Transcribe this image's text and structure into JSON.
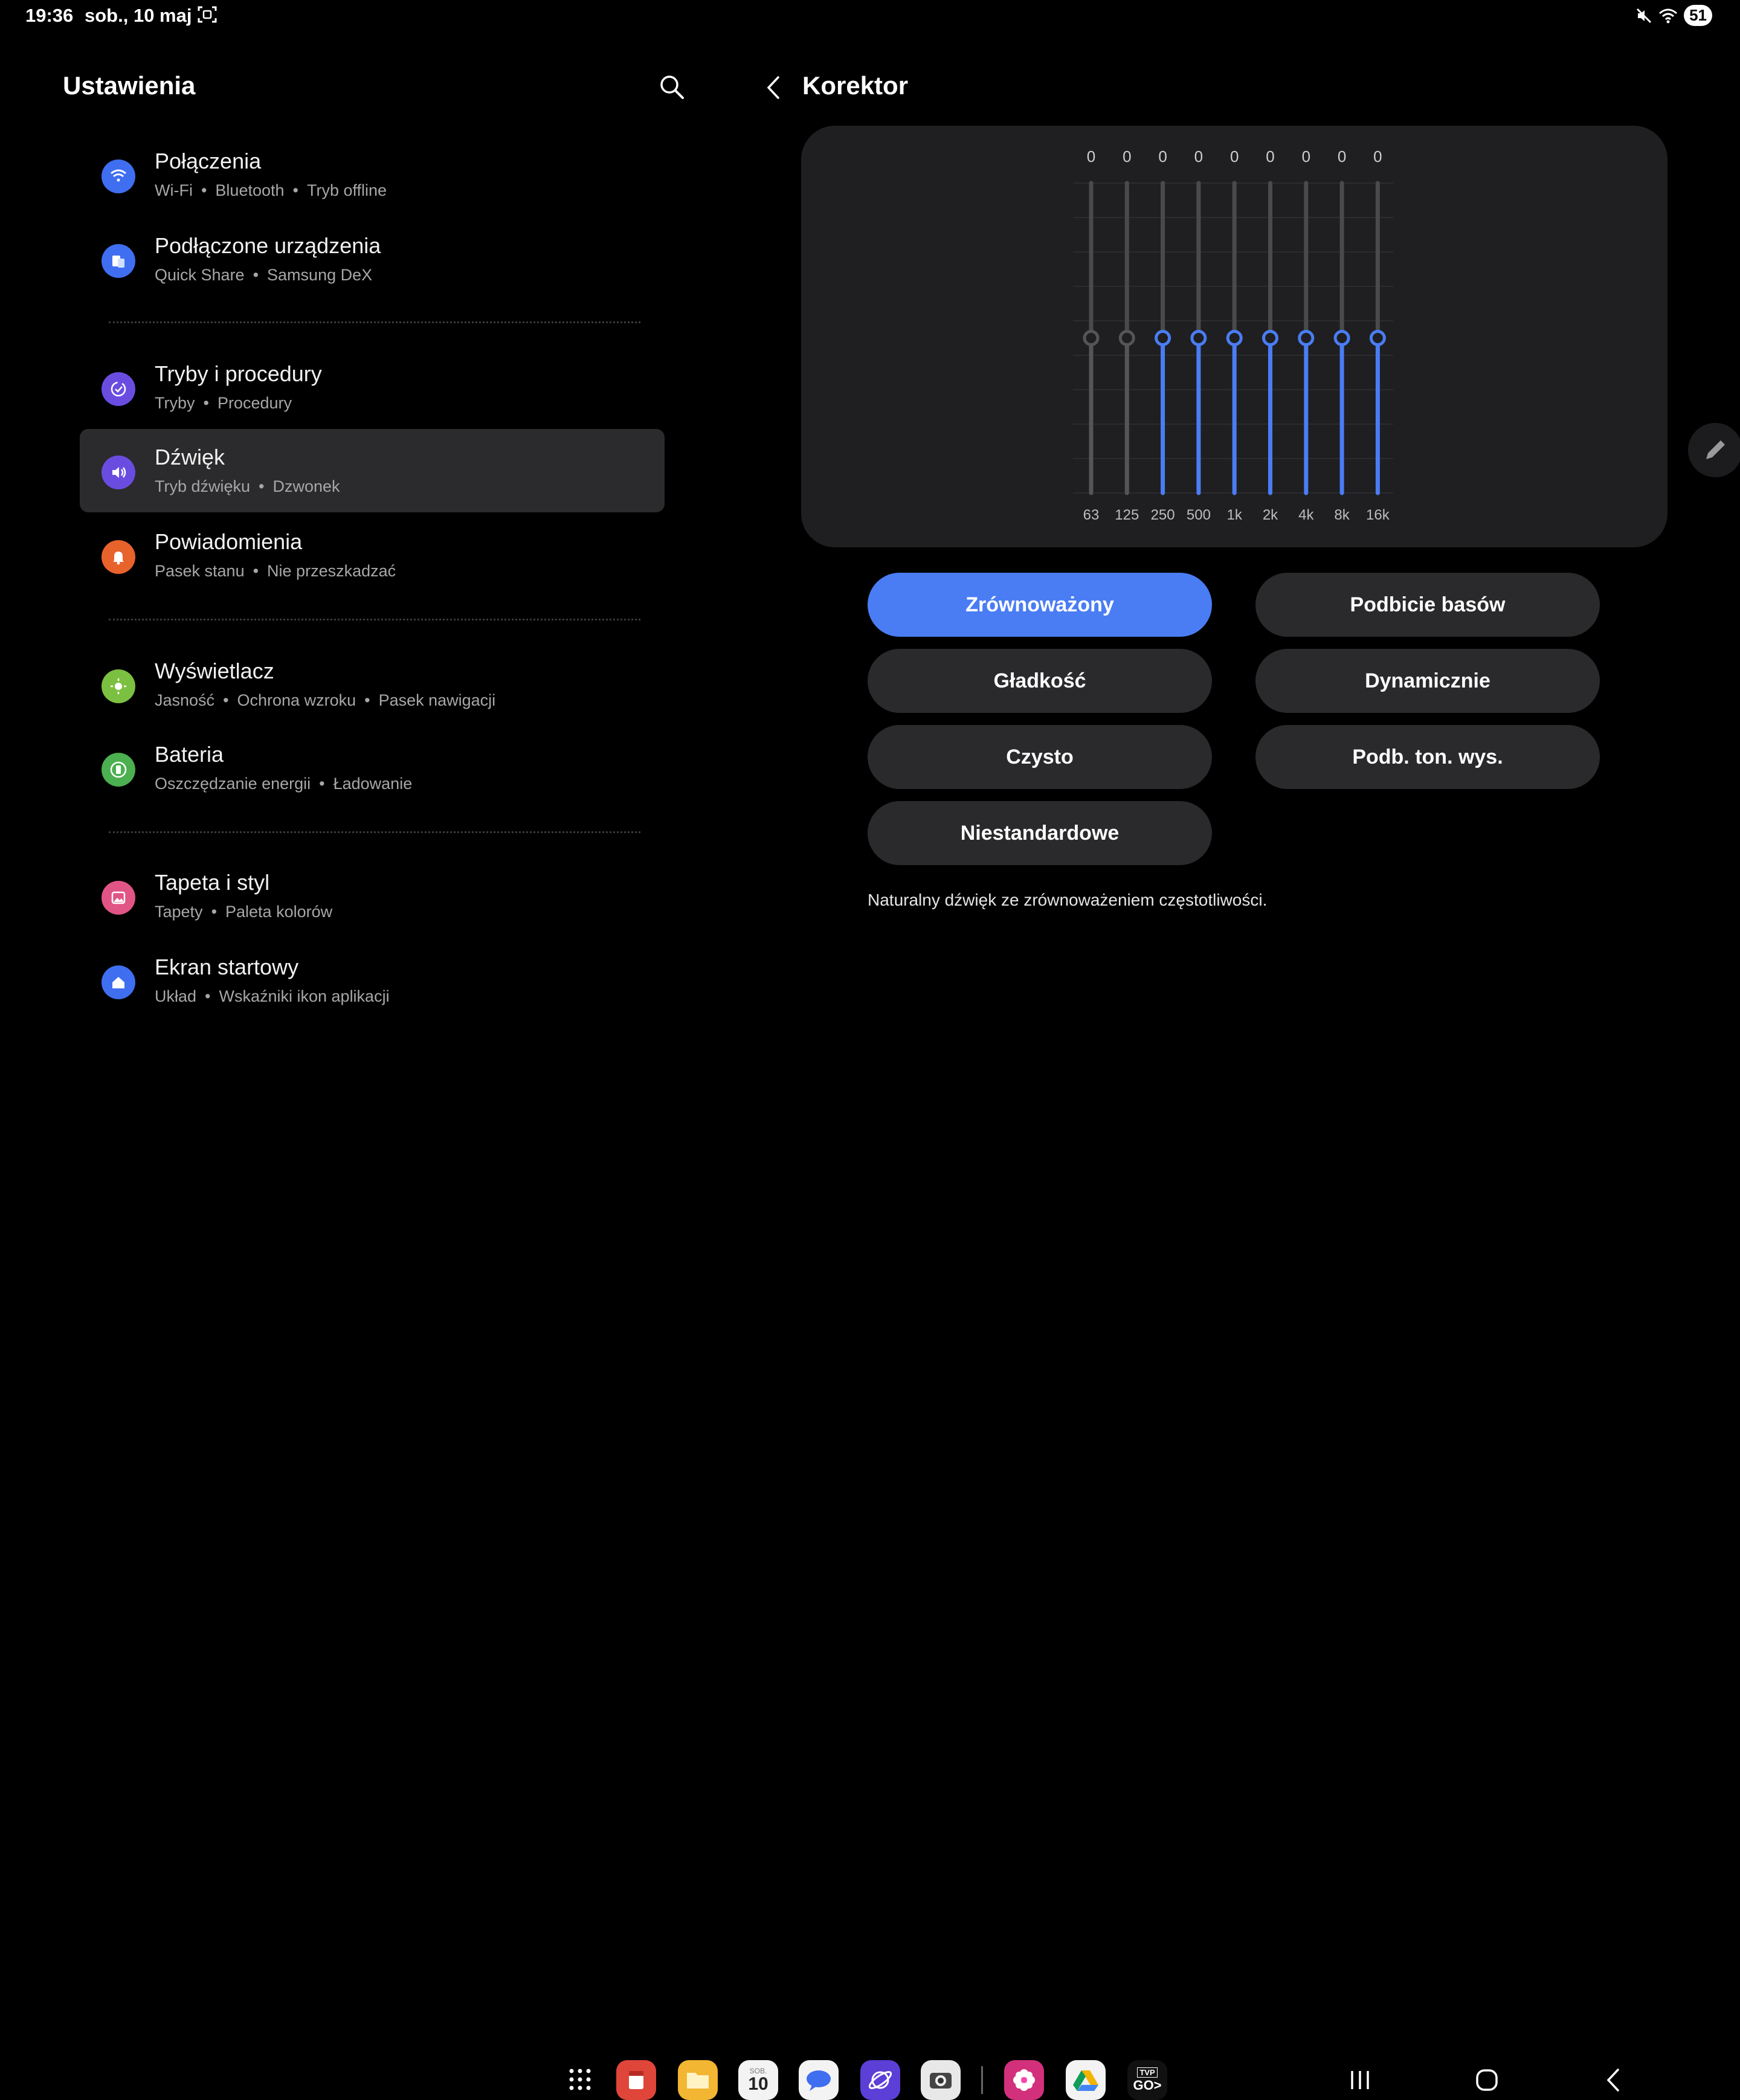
{
  "status_bar": {
    "time": "19:36",
    "date": "sob., 10 maj",
    "battery": "51"
  },
  "left": {
    "title": "Ustawienia",
    "items": [
      {
        "title": "Połączenia",
        "subs": [
          "Wi-Fi",
          "Bluetooth",
          "Tryb offline"
        ],
        "icon": "wifi-icon",
        "color": "#3f6ef0"
      },
      {
        "title": "Podłączone urządzenia",
        "subs": [
          "Quick Share",
          "Samsung DeX"
        ],
        "icon": "devices-icon",
        "color": "#3f6ef0"
      },
      {
        "title": "Tryby i procedury",
        "subs": [
          "Tryby",
          "Procedury"
        ],
        "icon": "routines-icon",
        "color": "#6a4de0"
      },
      {
        "title": "Dźwięk",
        "subs": [
          "Tryb dźwięku",
          "Dzwonek"
        ],
        "icon": "speaker-icon",
        "color": "#6a4de0"
      },
      {
        "title": "Powiadomienia",
        "subs": [
          "Pasek stanu",
          "Nie przeszkadzać"
        ],
        "icon": "bell-icon",
        "color": "#e8622c"
      },
      {
        "title": "Wyświetlacz",
        "subs": [
          "Jasność",
          "Ochrona wzroku",
          "Pasek nawigacji"
        ],
        "icon": "sun-icon",
        "color": "#7cc041"
      },
      {
        "title": "Bateria",
        "subs": [
          "Oszczędzanie energii",
          "Ładowanie"
        ],
        "icon": "battery-icon",
        "color": "#4caf50"
      },
      {
        "title": "Tapeta i styl",
        "subs": [
          "Tapety",
          "Paleta kolorów"
        ],
        "icon": "wallpaper-icon",
        "color": "#e05585"
      },
      {
        "title": "Ekran startowy",
        "subs": [
          "Układ",
          "Wskaźniki ikon aplikacji"
        ],
        "icon": "home-icon",
        "color": "#3f6ef0"
      }
    ]
  },
  "right": {
    "title": "Korektor",
    "equalizer": {
      "bands": [
        "63",
        "125",
        "250",
        "500",
        "1k",
        "2k",
        "4k",
        "8k",
        "16k"
      ],
      "values": [
        "0",
        "0",
        "0",
        "0",
        "0",
        "0",
        "0",
        "0",
        "0"
      ],
      "level": 0.5,
      "active_color": "#4a7df4",
      "inactive_color": "#555555"
    },
    "presets": [
      "Zrównoważony",
      "Podbicie basów",
      "Gładkość",
      "Dynamicznie",
      "Czysto",
      "Podb. ton. wys.",
      "Niestandardowe"
    ],
    "selected_preset": "Zrównoważony",
    "description": "Naturalny dźwięk ze zrównoważeniem częstotliwości."
  },
  "dock": {
    "calendar_day": "10",
    "calendar_month": "SOB.",
    "tvp_label": "TVP",
    "go_label": "GO>"
  }
}
